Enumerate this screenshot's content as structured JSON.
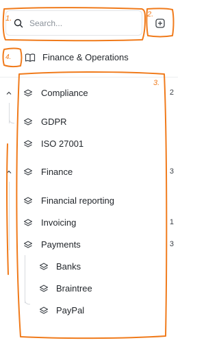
{
  "search": {
    "placeholder": "Search..."
  },
  "workspace": {
    "label": "Finance & Operations"
  },
  "tree": {
    "compliance": {
      "label": "Compliance",
      "count": "2"
    },
    "gdpr": {
      "label": "GDPR"
    },
    "iso": {
      "label": "ISO 27001"
    },
    "finance": {
      "label": "Finance",
      "count": "3"
    },
    "reporting": {
      "label": "Financial reporting"
    },
    "invoicing": {
      "label": "Invoicing",
      "count": "1"
    },
    "payments": {
      "label": "Payments",
      "count": "3"
    },
    "banks": {
      "label": "Banks"
    },
    "braintree": {
      "label": "Braintree"
    },
    "paypal": {
      "label": "PayPal"
    }
  },
  "annotations": {
    "one": "1.",
    "two": "2.",
    "three": "3.",
    "four": "4."
  },
  "colors": {
    "annotation": "#f07a1a",
    "text": "#1f2328",
    "border": "#e3e5e8"
  }
}
